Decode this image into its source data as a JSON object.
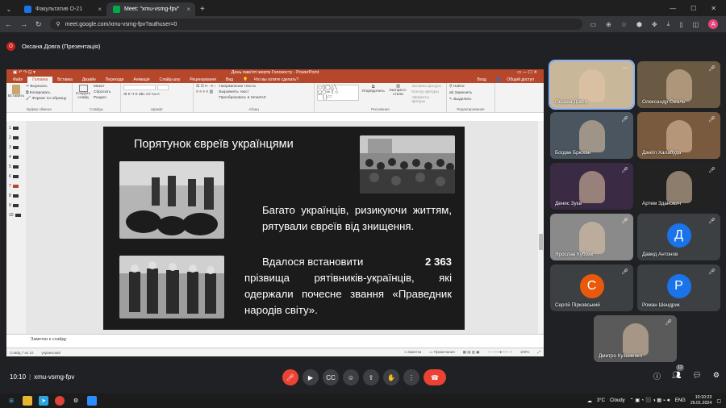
{
  "browser": {
    "tabs": [
      {
        "label": "Факультатив О-21",
        "active": false,
        "favicon_color": "#1a73e8"
      },
      {
        "label": "Meet: \"xmu-vsmg-fpv\"",
        "active": true,
        "favicon_color": "#00ac47"
      }
    ],
    "new_tab": "+",
    "url": "meet.google.com/xmu-vsmg-fpv?authuser=0",
    "profile_initial": "A"
  },
  "meet": {
    "presenter_initial": "О",
    "presenter_label": "Оксана Довга (Презентація)",
    "meeting_time": "10:10",
    "separator": "|",
    "meeting_code": "xmu-vsmg-fpv",
    "participants_count": "12"
  },
  "powerpoint": {
    "window_title": "День пам'яті жертв Голокосту - PowerPoint",
    "tabs": [
      "Файл",
      "Головна",
      "Вставка",
      "Дизайн",
      "Переходи",
      "Анімація",
      "Слайд-шоу",
      "Рецензування",
      "Вид"
    ],
    "tell_me": "Что вы хотите сделать?",
    "signin": "Вход",
    "share": "Общий доступ",
    "ribbon": {
      "paste": "Вставить",
      "cut": "Вырезать",
      "copy": "Копировать",
      "format_painter": "Формат по образцу",
      "clipboard_group": "Буфер обмена",
      "new_slide": "Создать слайд",
      "layout": "Макет",
      "reset": "Сбросить",
      "section": "Раздел",
      "slides_group": "Слайды",
      "font_group": "Шрифт",
      "text_direction": "Направление текста",
      "align_text": "Выровнять текст",
      "smartart": "Преобразовать в SmartArt",
      "paragraph_group": "Абзац",
      "arrange": "Упорядочить",
      "quick_styles": "Экспресс-стили",
      "shape_fill": "Заливка фигуры",
      "shape_outline": "Контур фигуры",
      "shape_effects": "Эффекты фигуры",
      "drawing_group": "Рисование",
      "find": "Найти",
      "replace": "Заменить",
      "select": "Выделить",
      "editing_group": "Редактирование"
    },
    "thumbnails": [
      "1",
      "2",
      "3",
      "4",
      "5",
      "6",
      "7",
      "8",
      "9",
      "10"
    ],
    "slide": {
      "title": "Порятунок євреїв українцями",
      "body1": "Багато українців, ризикуючи життям, рятували євреїв від знищення.",
      "body2_lead": "Вдалося встановити",
      "body2_number": "2 363",
      "body2_rest": "прізвища рятівників-українців, які одержали почесне звання «Праведник народів світу»."
    },
    "notes_placeholder": "Заметки к слайду",
    "status": {
      "slide_of": "Слайд 7 из 10",
      "language": "украинский",
      "notes_btn": "Заметки",
      "comments_btn": "Примечания",
      "zoom": "100%"
    }
  },
  "participants": [
    {
      "name": "Оксана Довга",
      "type": "video",
      "speaking": true
    },
    {
      "name": "Олександр Смаль",
      "type": "video"
    },
    {
      "name": "Богдан Брюхан",
      "type": "video"
    },
    {
      "name": "Даніїл Халабуда",
      "type": "video"
    },
    {
      "name": "Денис Зуєв",
      "type": "video"
    },
    {
      "name": "Артем Зданович",
      "type": "video"
    },
    {
      "name": "Ярослав Кубрак",
      "type": "video"
    },
    {
      "name": "Давид Антонов",
      "type": "avatar",
      "initial": "Д",
      "color": "#1a73e8"
    },
    {
      "name": "Сергій Пірковський",
      "type": "avatar",
      "initial": "С",
      "color": "#e8590c"
    },
    {
      "name": "Роман Шендрик",
      "type": "avatar",
      "initial": "Р",
      "color": "#1a73e8"
    },
    {
      "name": "Дмитро Кузьменко",
      "type": "video"
    }
  ],
  "taskbar": {
    "weather_temp": "3°C",
    "weather_text": "Cloudy",
    "lang": "ENG",
    "time": "10:10:23",
    "date": "26.01.2024"
  }
}
